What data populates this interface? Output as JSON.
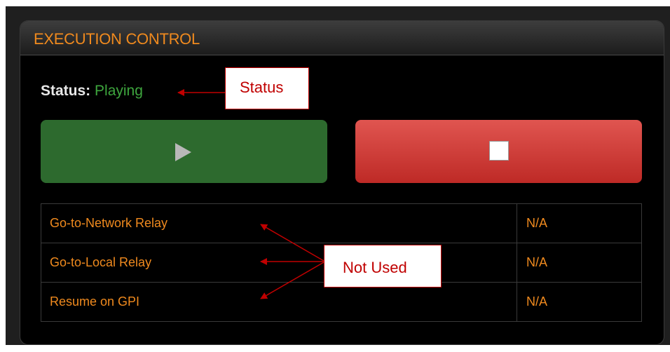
{
  "panel": {
    "title": "EXECUTION CONTROL"
  },
  "status": {
    "label": "Status:",
    "value": "Playing"
  },
  "buttons": {
    "play_icon": "play-icon",
    "stop_icon": "stop-icon"
  },
  "relays": [
    {
      "name": "Go-to-Network Relay",
      "value": "N/A"
    },
    {
      "name": "Go-to-Local Relay",
      "value": "N/A"
    },
    {
      "name": "Resume on GPI",
      "value": "N/A"
    }
  ],
  "annotations": {
    "status": "Status",
    "not_used": "Not Used"
  },
  "colors": {
    "accent": "#f08a1e",
    "status_playing": "#3ea63e",
    "play_button": "#2d6a2e",
    "stop_button": "#d0403b",
    "annotation": "#c00000"
  }
}
